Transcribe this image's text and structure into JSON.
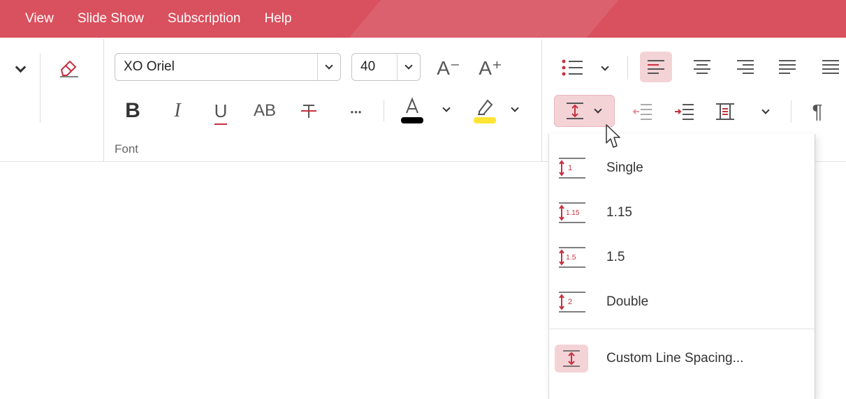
{
  "menubar": {
    "items": [
      "View",
      "Slide Show",
      "Subscription",
      "Help"
    ],
    "background": "#d9505e"
  },
  "font": {
    "name": "XO Oriel",
    "size": "40",
    "group_label": "Font",
    "text_color": "#000000",
    "highlight_color": "#ffe433"
  },
  "ribbon_icons": {
    "grow_font": "A⁺",
    "shrink_font": "A⁻",
    "bold": "B",
    "italic": "I",
    "underline": "U",
    "caps": "AB",
    "more": "•••",
    "pilcrow": "¶"
  },
  "line_spacing_menu": {
    "items": [
      {
        "label": "Single",
        "icon_text": "1",
        "icon": "line-spacing-single-icon"
      },
      {
        "label": "1.15",
        "icon_text": "1.15",
        "icon": "line-spacing-1-15-icon"
      },
      {
        "label": "1.5",
        "icon_text": "1.5",
        "icon": "line-spacing-1-5-icon"
      },
      {
        "label": "Double",
        "icon_text": "2",
        "icon": "line-spacing-double-icon"
      }
    ],
    "custom": {
      "label": "Custom Line Spacing...",
      "icon": "custom-line-spacing-icon"
    }
  },
  "colors": {
    "accent": "#d9505e",
    "icon_red": "#c8303f",
    "active_bg": "#f4d3d7"
  }
}
